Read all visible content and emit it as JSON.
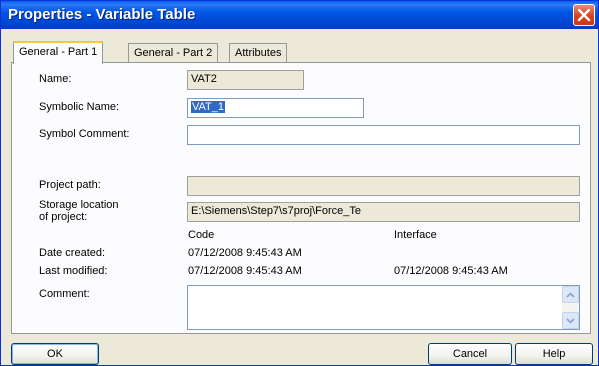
{
  "window": {
    "title": "Properties - Variable Table"
  },
  "tabs": [
    {
      "label": "General - Part 1",
      "active": true
    },
    {
      "label": "General - Part 2",
      "active": false
    },
    {
      "label": "Attributes",
      "active": false
    }
  ],
  "form": {
    "name_label": "Name:",
    "name_value": "VAT2",
    "symbolic_name_label": "Symbolic Name:",
    "symbolic_name_value": "VAT_1",
    "symbol_comment_label": "Symbol Comment:",
    "symbol_comment_value": "",
    "project_path_label": "Project path:",
    "project_path_value": "",
    "storage_label_line1": "Storage location",
    "storage_label_line2": "of project:",
    "storage_value": "E:\\Siemens\\Step7\\s7proj\\Force_Te",
    "code_header": "Code",
    "interface_header": "Interface",
    "date_created_label": "Date created:",
    "date_created_code": "07/12/2008  9:45:43 AM",
    "date_created_interface": "",
    "last_modified_label": "Last modified:",
    "last_modified_code": "07/12/2008  9:45:43 AM",
    "last_modified_interface": "07/12/2008  9:45:43 AM",
    "comment_label": "Comment:",
    "comment_value": ""
  },
  "buttons": {
    "ok": "OK",
    "cancel": "Cancel",
    "help": "Help"
  },
  "colors": {
    "titlebar": "#0054e3",
    "dialog_bg": "#ece9d8",
    "selection": "#316ac5",
    "close_button": "#d7431d"
  },
  "icons": {
    "close": "close-icon",
    "scroll_up": "scroll-up-arrow-icon",
    "scroll_down": "scroll-down-arrow-icon"
  }
}
